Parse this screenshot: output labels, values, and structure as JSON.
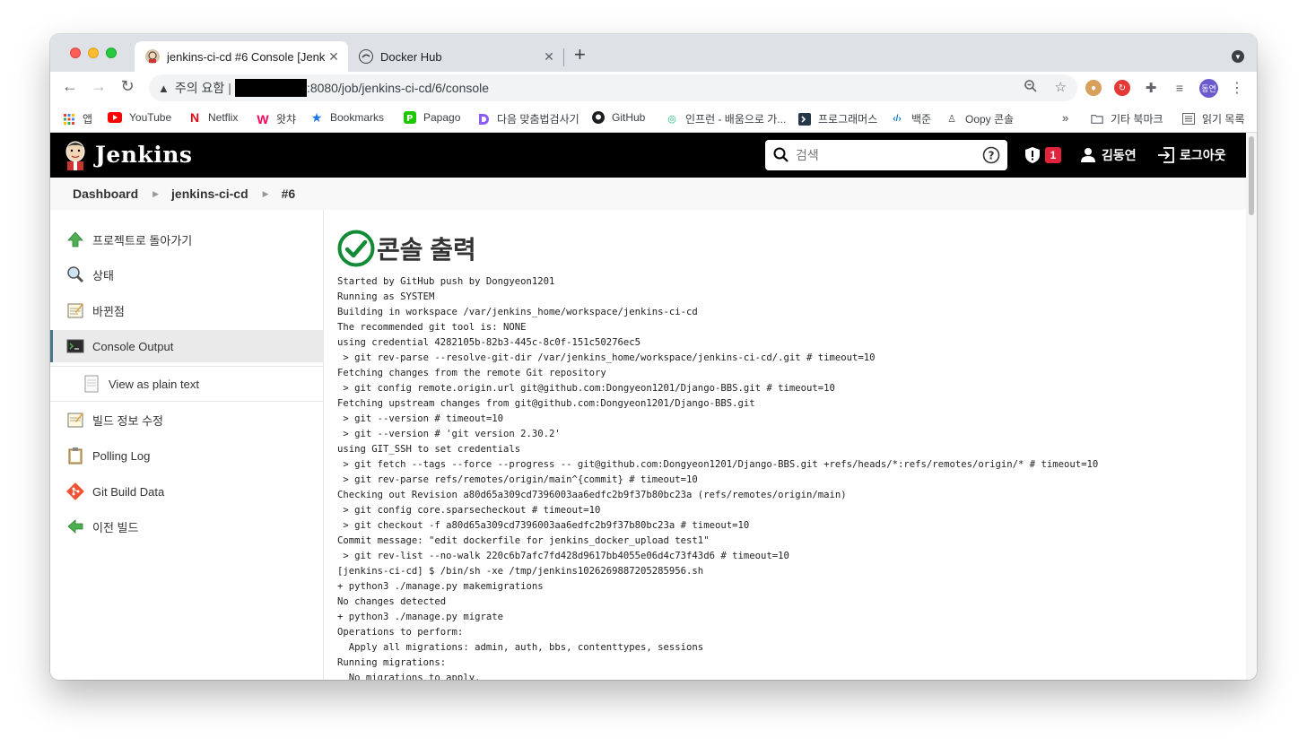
{
  "browser": {
    "tabs": [
      {
        "title": "jenkins-ci-cd #6 Console [Jenkins]",
        "active": true
      },
      {
        "title": "Docker Hub",
        "active": false
      }
    ],
    "address": {
      "warning": "주의 요함",
      "url_path": ":8080/job/jenkins-ci-cd/6/console"
    },
    "bookmarks": [
      {
        "label": "앱",
        "icon": "apps-grid-icon"
      },
      {
        "label": "YouTube",
        "icon": "youtube-icon"
      },
      {
        "label": "Netflix",
        "icon": "netflix-icon"
      },
      {
        "label": "왓챠",
        "icon": "watcha-icon"
      },
      {
        "label": "Bookmarks",
        "icon": "star-icon"
      },
      {
        "label": "Papago",
        "icon": "papago-icon"
      },
      {
        "label": "다음 맞춤법검사기",
        "icon": "daum-icon"
      },
      {
        "label": "GitHub",
        "icon": "github-icon"
      },
      {
        "label": "인프런 - 배움으로 가...",
        "icon": "inflearn-icon"
      },
      {
        "label": "프로그래머스",
        "icon": "programmers-icon"
      },
      {
        "label": "백준",
        "icon": "baekjoon-icon"
      },
      {
        "label": "Oopy 콘솔",
        "icon": "oopy-icon"
      }
    ],
    "bookmarks_more": "»",
    "other_bookmarks": "기타 북마크",
    "reading_list": "읽기 목록",
    "profile_initials": "동연"
  },
  "jenkins": {
    "brand": "Jenkins",
    "search_placeholder": "검색",
    "alert_count": "1",
    "user_name": "김동연",
    "logout_label": "로그아웃",
    "breadcrumb": [
      "Dashboard",
      "jenkins-ci-cd",
      "#6"
    ],
    "sidebar": [
      {
        "label": "프로젝트로 돌아가기",
        "icon": "up-arrow-icon"
      },
      {
        "label": "상태",
        "icon": "search-icon"
      },
      {
        "label": "바뀐점",
        "icon": "notepad-icon"
      },
      {
        "label": "Console Output",
        "icon": "terminal-icon",
        "active": true
      },
      {
        "label": "View as plain text",
        "icon": "document-icon"
      },
      {
        "label": "빌드 정보 수정",
        "icon": "notepad-edit-icon"
      },
      {
        "label": "Polling Log",
        "icon": "clipboard-icon"
      },
      {
        "label": "Git Build Data",
        "icon": "git-icon"
      },
      {
        "label": "이전 빌드",
        "icon": "left-arrow-icon"
      }
    ],
    "console_title": "콘솔 출력",
    "console_log": "Started by GitHub push by Dongyeon1201\nRunning as SYSTEM\nBuilding in workspace /var/jenkins_home/workspace/jenkins-ci-cd\nThe recommended git tool is: NONE\nusing credential 4282105b-82b3-445c-8c0f-151c50276ec5\n > git rev-parse --resolve-git-dir /var/jenkins_home/workspace/jenkins-ci-cd/.git # timeout=10\nFetching changes from the remote Git repository\n > git config remote.origin.url git@github.com:Dongyeon1201/Django-BBS.git # timeout=10\nFetching upstream changes from git@github.com:Dongyeon1201/Django-BBS.git\n > git --version # timeout=10\n > git --version # 'git version 2.30.2'\nusing GIT_SSH to set credentials\n > git fetch --tags --force --progress -- git@github.com:Dongyeon1201/Django-BBS.git +refs/heads/*:refs/remotes/origin/* # timeout=10\n > git rev-parse refs/remotes/origin/main^{commit} # timeout=10\nChecking out Revision a80d65a309cd7396003aa6edfc2b9f37b80bc23a (refs/remotes/origin/main)\n > git config core.sparsecheckout # timeout=10\n > git checkout -f a80d65a309cd7396003aa6edfc2b9f37b80bc23a # timeout=10\nCommit message: \"edit dockerfile for jenkins_docker_upload test1\"\n > git rev-list --no-walk 220c6b7afc7fd428d9617bb4055e06d4c73f43d6 # timeout=10\n[jenkins-ci-cd] $ /bin/sh -xe /tmp/jenkins1026269887205285956.sh\n+ python3 ./manage.py makemigrations\nNo changes detected\n+ python3 ./manage.py migrate\nOperations to perform:\n  Apply all migrations: admin, auth, bbs, contenttypes, sessions\nRunning migrations:\n  No migrations to apply."
  }
}
